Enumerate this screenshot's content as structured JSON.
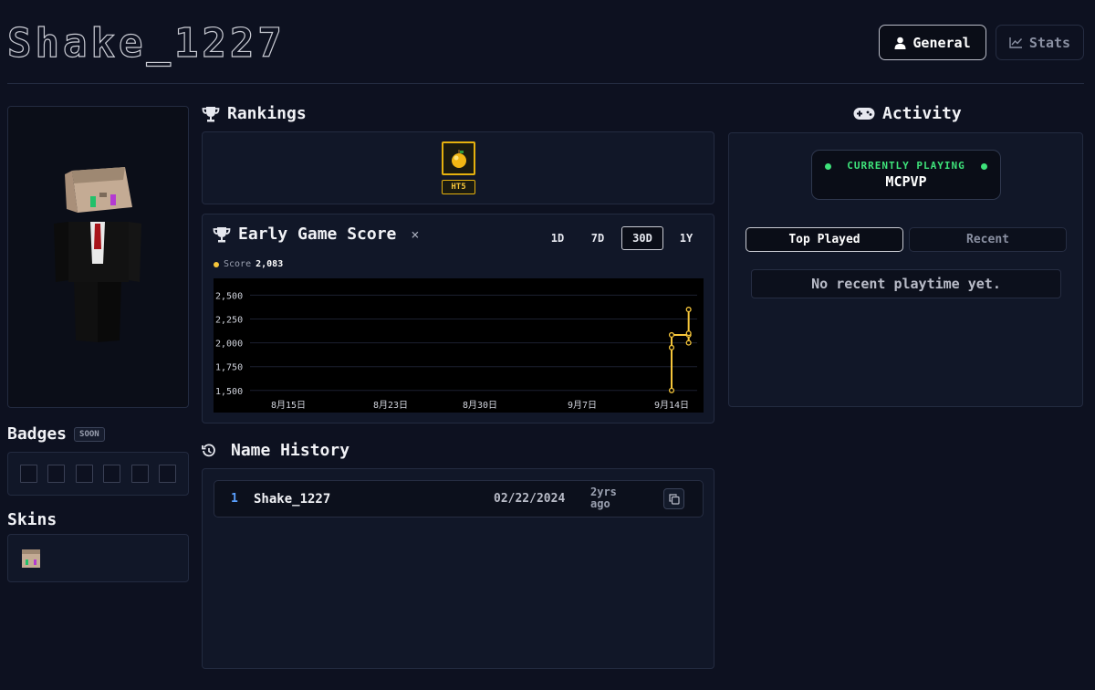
{
  "header": {
    "username": "Shake_1227",
    "tabs": [
      {
        "label": "General",
        "icon": "user-icon",
        "active": true
      },
      {
        "label": "Stats",
        "icon": "line-chart-icon",
        "active": false
      }
    ]
  },
  "badges": {
    "title": "Badges",
    "soon_label": "SOON",
    "slot_count": 6
  },
  "skins": {
    "title": "Skins"
  },
  "rankings": {
    "title": "Rankings",
    "items": [
      {
        "icon": "golden-apple-icon",
        "tier": "HT5"
      }
    ]
  },
  "score": {
    "title": "Early Game Score",
    "close_label": "×",
    "ranges": [
      "1D",
      "7D",
      "30D",
      "1Y"
    ],
    "active_range": "30D",
    "legend_label": "Score",
    "legend_value": "2,083"
  },
  "chart_data": {
    "type": "line",
    "series": [
      {
        "name": "Score",
        "color": "#f5c53a",
        "points": [
          {
            "x": "2024-09-14T00:00",
            "y": 1500
          },
          {
            "x": "2024-09-14T00:00",
            "y": 1950
          },
          {
            "x": "2024-09-14T00:00",
            "y": 2083
          },
          {
            "x": "2024-09-15T08:00",
            "y": 2083
          },
          {
            "x": "2024-09-15T08:00",
            "y": 2350
          },
          {
            "x": "2024-09-15T08:00",
            "y": 2100
          },
          {
            "x": "2024-09-15T08:00",
            "y": 2000
          }
        ]
      }
    ],
    "x_ticks": [
      "8月15日",
      "8月23日",
      "8月30日",
      "9月7日",
      "9月14日"
    ],
    "y_ticks": [
      "2,500",
      "2,250",
      "2,000",
      "1,750",
      "1,500"
    ],
    "ylim": [
      1450,
      2600
    ],
    "grid": true
  },
  "history": {
    "title": "Name History",
    "rows": [
      {
        "index": "1",
        "name": "Shake_1227",
        "date": "02/22/2024",
        "ago": "2yrs ago"
      }
    ]
  },
  "activity": {
    "title": "Activity",
    "playing_label": "CURRENTLY PLAYING",
    "playing_game": "MCPVP",
    "tabs": [
      "Top Played",
      "Recent"
    ],
    "active_tab": "Top Played",
    "empty_message": "No recent playtime yet."
  }
}
